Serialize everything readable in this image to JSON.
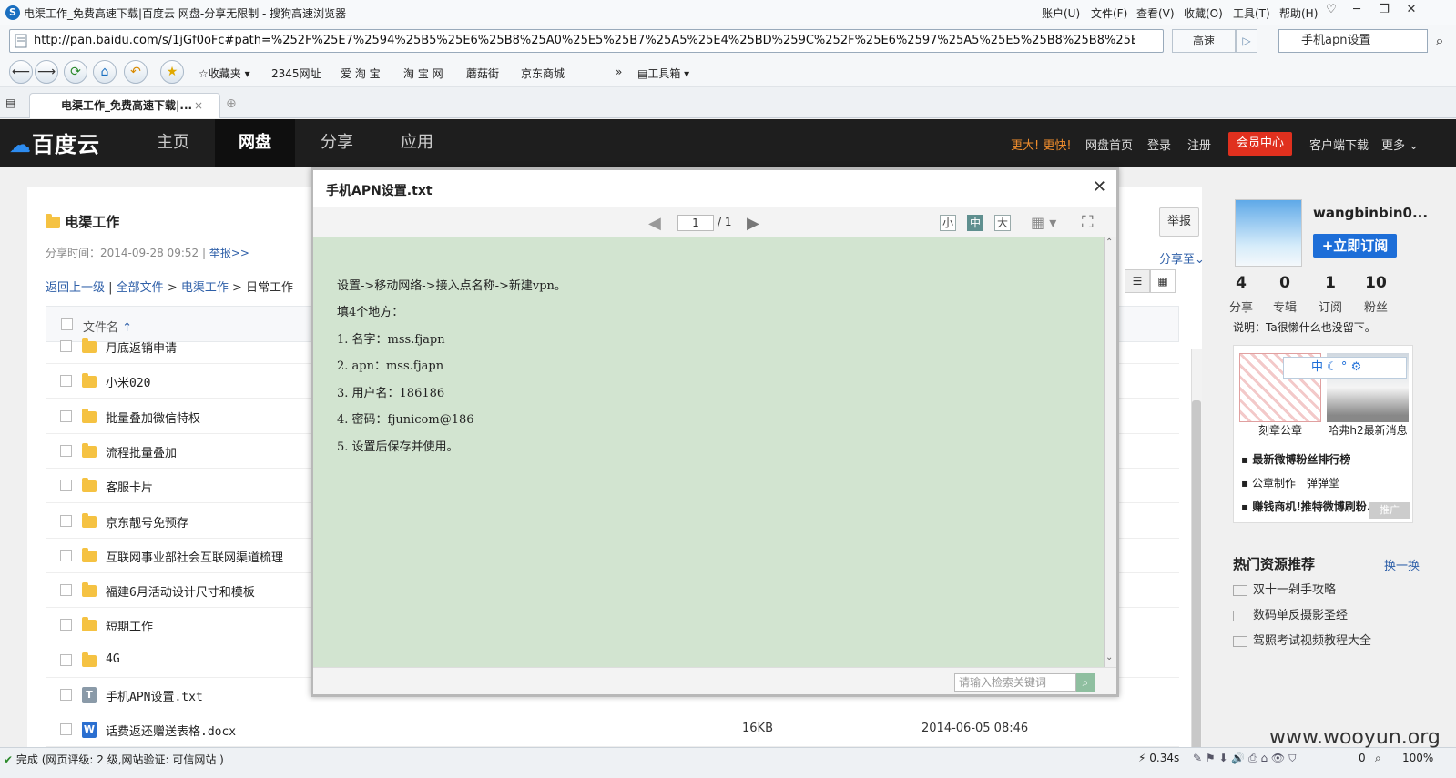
{
  "browser": {
    "title": "电渠工作_免费高速下载|百度云 网盘-分享无限制 - 搜狗高速浏览器",
    "menus": [
      "账户(U)",
      "文件(F)",
      "查看(V)",
      "收藏(O)",
      "工具(T)",
      "帮助(H)"
    ],
    "url": "http://pan.baidu.com/s/1jGf0oFc#path=%252F%25E7%2594%25B5%25E6%25B8%25A0%25E5%25B7%25A5%25E4%25BD%259C%252F%25E6%2597%25A5%25E5%25B8%25B8%25E5%25",
    "speed_label": "高速",
    "search_value": "手机apn设置",
    "favorites_label": "收藏夹",
    "bookmarks": [
      "2345网址",
      "爱 淘 宝",
      "淘 宝 网",
      "蘑菇街",
      "京东商城"
    ],
    "toolbox_label": "工具箱",
    "tab_title": "电渠工作_免费高速下载|..."
  },
  "site": {
    "logo": "百度云",
    "nav": [
      "主页",
      "网盘",
      "分享",
      "应用"
    ],
    "slogan": "更大! 更快!",
    "links": [
      "网盘首页",
      "登录",
      "注册"
    ],
    "vip": "会员中心",
    "client": "客户端下载",
    "more": "更多"
  },
  "folder": {
    "name": "电渠工作",
    "share_time": "分享时间：2014-09-28 09:52",
    "report_link": "举报>>",
    "breadcrumb": {
      "back": "返回上一级",
      "all": "全部文件",
      "parent": "电渠工作",
      "current": "日常工作"
    },
    "column_name": "文件名",
    "report_button": "举报",
    "share_to": "分享至"
  },
  "files": [
    {
      "name": "月底返销申请",
      "type": "folder",
      "size": "",
      "date": ""
    },
    {
      "name": "小米020",
      "type": "folder",
      "size": "",
      "date": ""
    },
    {
      "name": "批量叠加微信特权",
      "type": "folder",
      "size": "",
      "date": ""
    },
    {
      "name": "流程批量叠加",
      "type": "folder",
      "size": "",
      "date": ""
    },
    {
      "name": "客服卡片",
      "type": "folder",
      "size": "",
      "date": ""
    },
    {
      "name": "京东靓号免预存",
      "type": "folder",
      "size": "",
      "date": ""
    },
    {
      "name": "互联网事业部社会互联网渠道梳理",
      "type": "folder",
      "size": "",
      "date": ""
    },
    {
      "name": "福建6月活动设计尺寸和模板",
      "type": "folder",
      "size": "",
      "date": ""
    },
    {
      "name": "短期工作",
      "type": "folder",
      "size": "",
      "date": ""
    },
    {
      "name": "4G",
      "type": "folder",
      "size": "",
      "date": ""
    },
    {
      "name": "手机APN设置.txt",
      "type": "txt",
      "size": "",
      "date": ""
    },
    {
      "name": "话费返还赠送表格.docx",
      "type": "docx",
      "size": "16KB",
      "date": "2014-06-05 08:46"
    }
  ],
  "user": {
    "name": "wangbinbin0...",
    "subscribe": "+立即订阅",
    "stats": [
      {
        "n": "4",
        "l": "分享"
      },
      {
        "n": "0",
        "l": "专辑"
      },
      {
        "n": "1",
        "l": "订阅"
      },
      {
        "n": "10",
        "l": "粉丝"
      }
    ],
    "desc": "说明：Ta很懒什么也没留下。"
  },
  "ads": {
    "captions": [
      "刻章公章",
      "哈弗h2最新消息"
    ],
    "links": [
      "最新微博粉丝排行榜",
      "公章制作　弹弹堂",
      "赚钱商机!推特微博刷粉..."
    ],
    "promo": "推广",
    "ime": "中"
  },
  "hot": {
    "title": "热门资源推荐",
    "swap": "换一换",
    "items": [
      "双十一剁手攻略",
      "数码单反摄影圣经",
      "驾照考试视频教程大全"
    ]
  },
  "modal": {
    "title": "手机APN设置.txt",
    "page": "1",
    "total": "/ 1",
    "sizes": [
      "小",
      "中",
      "大"
    ],
    "lines": [
      "设置->移动网络->接入点名称->新建vpn。",
      "填4个地方：",
      "1.   名字：mss.fjapn",
      "2.   apn：mss.fjapn",
      "3.   用户名：186186",
      "4.   密码：fjunicom@186",
      "5.   设置后保存并使用。"
    ],
    "search_placeholder": "请输入检索关键词"
  },
  "statusbar": {
    "left": "完成 (网页评级: 2 级,网站验证: 可信网站 )",
    "time": "0.34s",
    "count": "0",
    "zoom": "100%"
  },
  "watermark": "www.wooyun.org",
  "colors": {
    "accent": "#1d6ed8",
    "vip": "#e0301e",
    "viewer_bg": "#d2e4d0",
    "header_bg": "#1e1e1e"
  }
}
